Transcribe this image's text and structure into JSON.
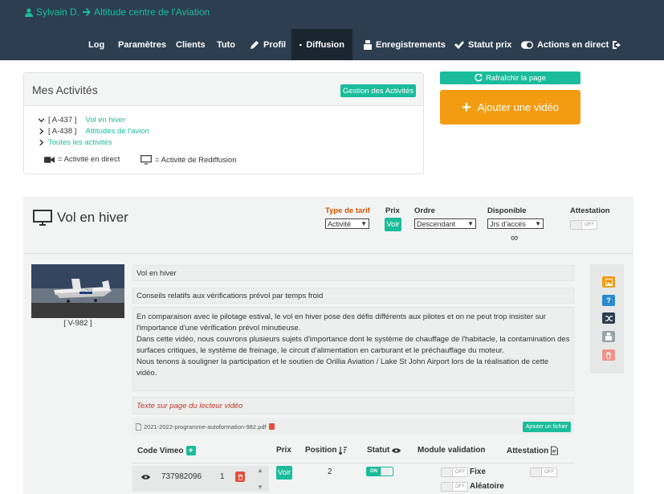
{
  "header": {
    "user_name": "Sylvain D.",
    "org_name": "Altitude centre de l'Aviation"
  },
  "nav": {
    "log": "Log",
    "parametres": "Paramètres",
    "clients": "Clients",
    "tuto": "Tuto",
    "profil": "Profil",
    "diffusion": "Diffusion",
    "enregistrements": "Enregistrements",
    "statut_prix": "Statut prix",
    "actions": "Actions en direct"
  },
  "activities_panel": {
    "title": "Mes Activités",
    "manage_button": "Gestion des Activités",
    "items": [
      {
        "code": "[ A-437 ]",
        "name": "Vol en hiver"
      },
      {
        "code": "[ A-438 ]",
        "name": "Attitudes de l'avion"
      }
    ],
    "all_link": "Toutes les activités",
    "legend_live": "= Activité en direct",
    "legend_replay": "= Activité de Rediffusion"
  },
  "actions": {
    "refresh": "Rafraîchir la page",
    "add_video": "Ajouter une vidéo"
  },
  "activity": {
    "title": "Vol en hiver",
    "tarif_label": "Type de tarif",
    "tarif_value": "Activité",
    "prix_label": "Prix",
    "voir": "Voir",
    "ordre_label": "Ordre",
    "ordre_value": "Descendant",
    "disponible_label": "Disponible",
    "disponible_value": "Jrs d'accès",
    "disponible_infinite": "∞",
    "attestation_label": "Attestation",
    "attestation_toggle": "OFF"
  },
  "video": {
    "code": "[ V-982 ]",
    "title": "Vol en hiver",
    "subtitle": "Conseils relatifs aux vérifications prévol par temps froid",
    "description_1": "En comparaison avec le pilotage estival, le vol en hiver pose des défis différents aux pilotes et on ne peut trop insister sur l'importance d'une vérification prévol minutieuse.",
    "description_2": "Dans cette vidéo, nous couvrons plusieurs sujets d'importance dont le système de chauffage de l'habitacle, la contamination des surfaces critiques, le système de freinage, le circuit d'alimentation en carburant et le préchauffage du moteur.",
    "description_3": "Nous tenons à souligner la participation et le soutien de Orillia Aviation / Lake St John Airport lors de la réalisation de cette vidéo.",
    "player_text": "Texte sur page du lecteur vidéo",
    "file_name": "2021-2022-programme-autoformation-982.pdf",
    "add_file": "Ajouter un fichier",
    "plane_reg": "C-FKEZ"
  },
  "table": {
    "headers": {
      "code": "Code Vimeo",
      "prix": "Prix",
      "position": "Position",
      "statut": "Statut",
      "module": "Module validation",
      "attestation": "Attestation"
    },
    "row": {
      "vimeo_id": "737982096",
      "index": "1",
      "voir": "Voir",
      "position": "2",
      "statut": "ON",
      "fixe_toggle": "OFF",
      "fixe_label": "Fixe",
      "aleatoire_toggle": "OFF",
      "aleatoire_label": "Aléatoire",
      "attestation_toggle": "OFF"
    }
  },
  "colors": {
    "nav_bg": "#2c3e50",
    "accent": "#1abc9c",
    "orange": "#f39c12",
    "danger": "#e74c3c"
  }
}
